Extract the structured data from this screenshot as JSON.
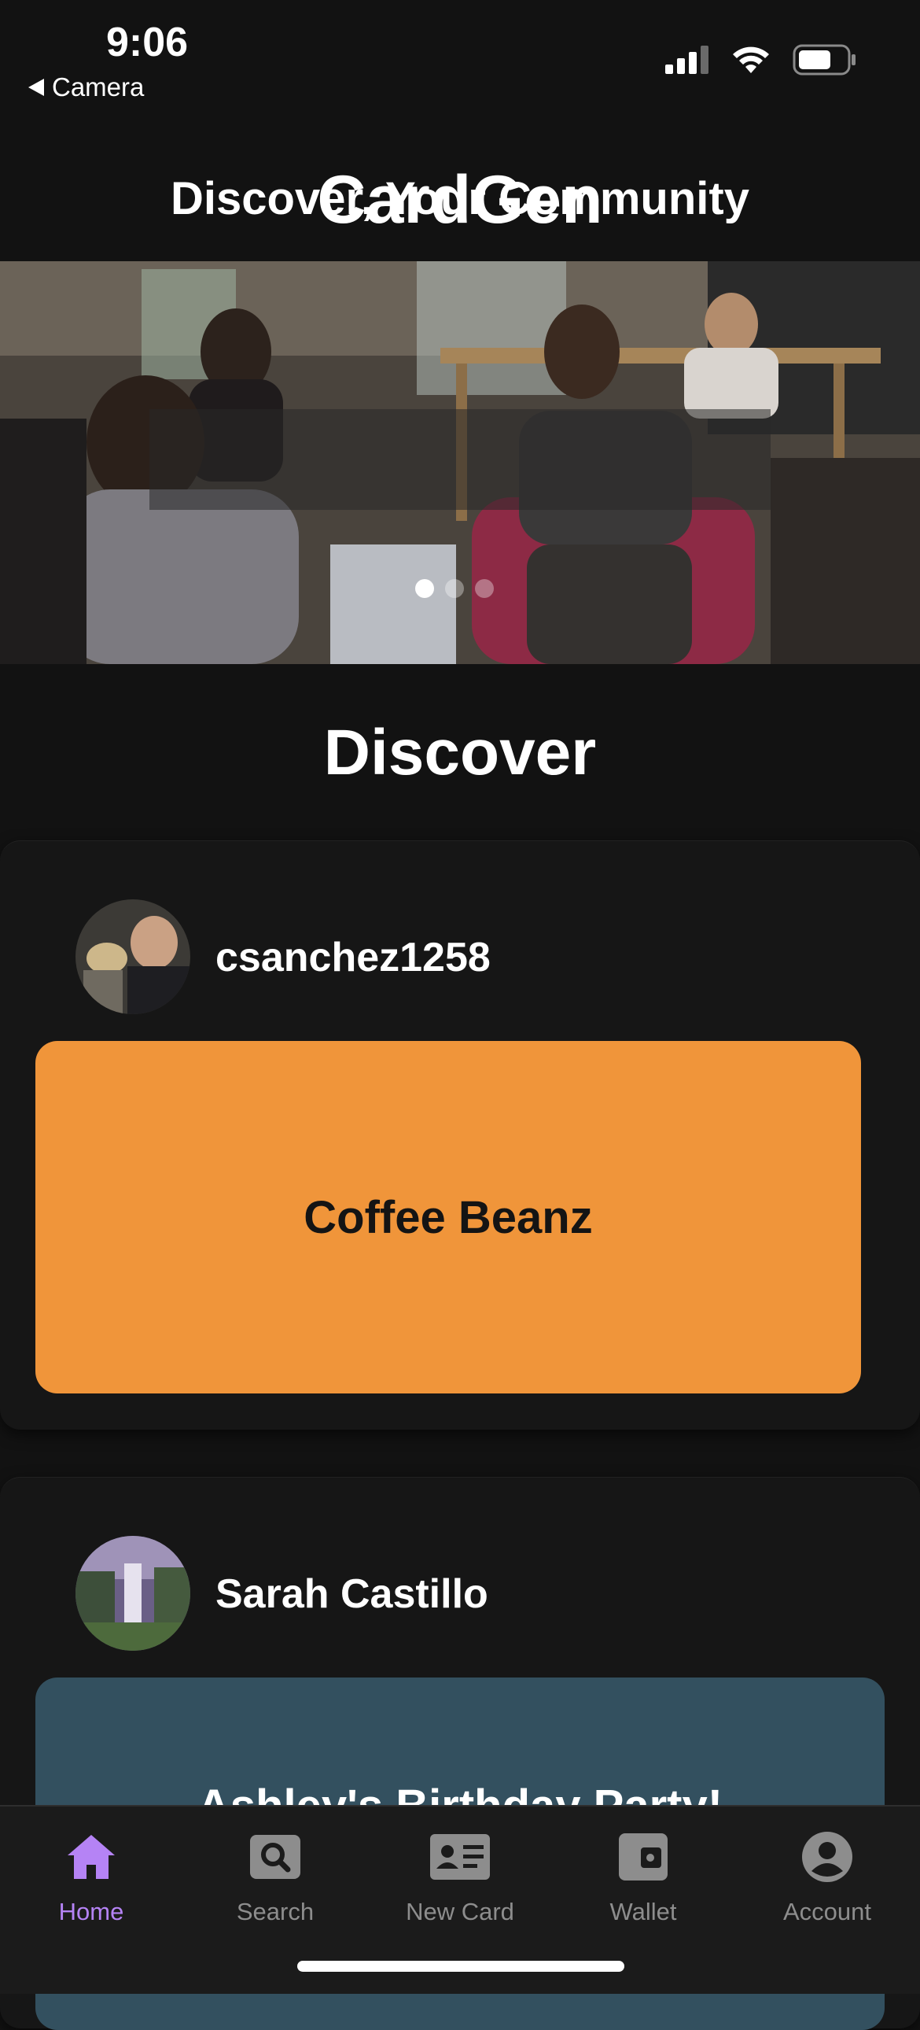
{
  "status_bar": {
    "time": "9:06",
    "back_label": "Camera",
    "icons": [
      "cellular-signal-icon",
      "wifi-icon",
      "battery-icon"
    ]
  },
  "header": {
    "title": "CardGen"
  },
  "hero": {
    "caption": "Discover, Your Community",
    "slide_count": 3,
    "active_slide": 1
  },
  "section": {
    "title": "Discover"
  },
  "posts": [
    {
      "username": "csanchez1258",
      "card_title": "Coffee Beanz",
      "card_color": "#f0953a"
    },
    {
      "username": "Sarah Castillo",
      "card_title": "Ashley's Birthday Party!",
      "card_color": "#33505f"
    }
  ],
  "tabs": [
    {
      "label": "Home",
      "icon": "home-icon",
      "active": true
    },
    {
      "label": "Search",
      "icon": "search-icon",
      "active": false
    },
    {
      "label": "New Card",
      "icon": "id-card-icon",
      "active": false
    },
    {
      "label": "Wallet",
      "icon": "wallet-icon",
      "active": false
    },
    {
      "label": "Account",
      "icon": "account-icon",
      "active": false
    }
  ],
  "colors": {
    "background": "#121212",
    "accent": "#b583f5",
    "inactive": "#8d8d8d"
  }
}
